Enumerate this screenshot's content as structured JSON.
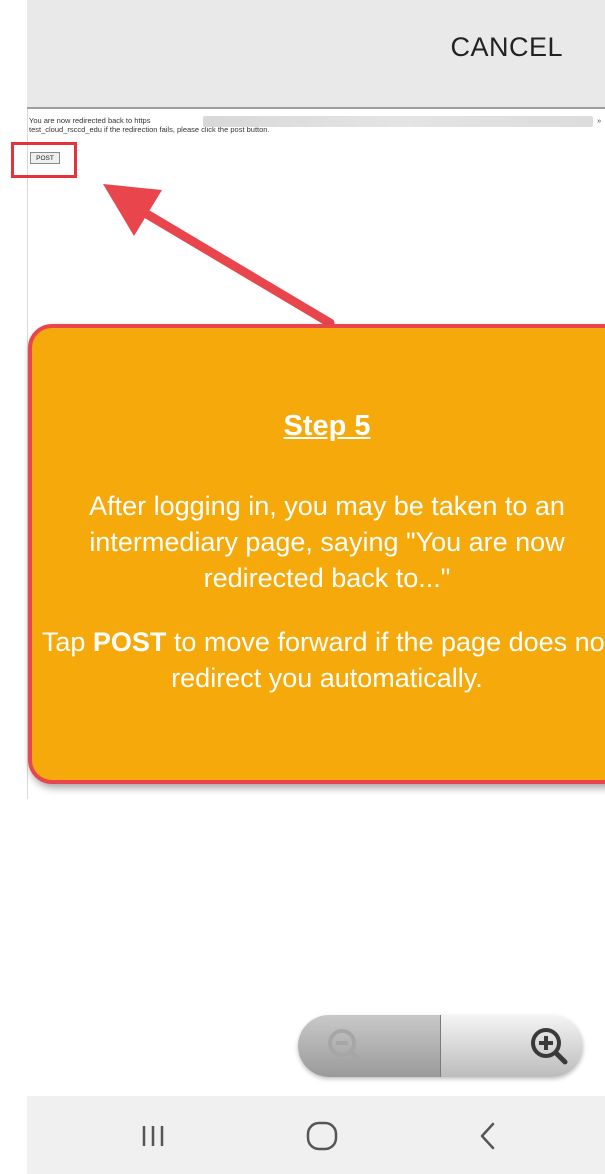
{
  "header": {
    "cancel_label": "CANCEL"
  },
  "redirect_page": {
    "line1": "You are now redirected back to https",
    "line2": "test_cloud_rsccd_edu if the redirection fails, please click the post button.",
    "url_end": "»",
    "post_button_label": "POST"
  },
  "callout": {
    "title": "Step 5",
    "paragraph1": "After logging in, you may be taken to an intermediary page, saying \"You are now redirected back to...\"",
    "paragraph2_before": "Tap",
    "paragraph2_bold": "POST",
    "paragraph2_after": "to move forward if the page does not redirect you automatically.",
    "background_color": "#f5a90a",
    "border_color": "#e8464c"
  },
  "zoom_control": {
    "zoom_out_icon": "zoom-out-icon",
    "zoom_in_icon": "zoom-in-icon"
  },
  "navbar": {
    "items": [
      {
        "icon": "recent-apps-icon"
      },
      {
        "icon": "home-icon"
      },
      {
        "icon": "back-icon"
      }
    ]
  },
  "colors": {
    "highlight_red": "#e5333b",
    "arrow_red": "#e8464c"
  }
}
